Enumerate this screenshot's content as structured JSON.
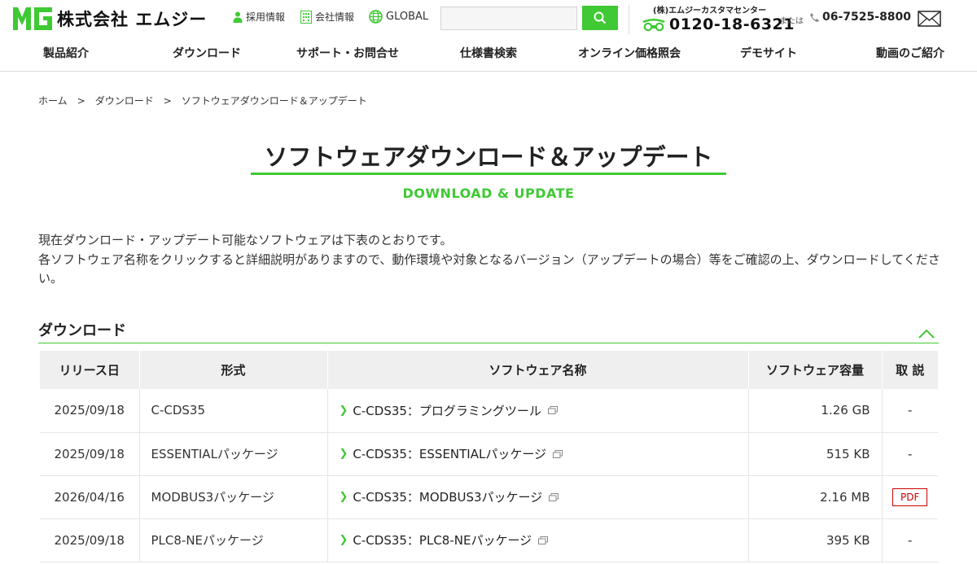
{
  "header": {
    "logo_mark": "MG",
    "logo_text": "株式会社 エムジー",
    "utility": {
      "recruit": "採用情報",
      "company": "会社情報",
      "global": "GLOBAL"
    },
    "search": {
      "placeholder": ""
    },
    "contact": {
      "center_label": "(株)エムジーカスタマセンター",
      "toll_free": "0120-18-6321",
      "or_label": "または",
      "phone": "06-7525-8800"
    },
    "nav": [
      "製品紹介",
      "ダウンロード",
      "サポート・お問合せ",
      "仕様書検索",
      "オンライン価格照会",
      "デモサイト",
      "動画のご紹介"
    ]
  },
  "breadcrumb": [
    "ホーム",
    "ダウンロード",
    "ソフトウェアダウンロード＆アップデート"
  ],
  "breadcrumb_sep": ">",
  "page": {
    "title": "ソフトウェアダウンロード＆アップデート",
    "subtitle": "DOWNLOAD & UPDATE",
    "intro_1": "現在ダウンロード・アップデート可能なソフトウェアは下表のとおりです。",
    "intro_2": "各ソフトウェア名称をクリックすると詳細説明がありますので、動作環境や対象となるバージョン（アップデートの場合）等をご確認の上、ダウンロードしてください。"
  },
  "section": {
    "title": "ダウンロード",
    "columns": [
      "リリース日",
      "形式",
      "ソフトウェア名称",
      "ソフトウェア容量",
      "取 説"
    ],
    "rows": [
      {
        "date": "2025/09/18",
        "type": "C-CDS35",
        "name": "C-CDS35：プログラミングツール",
        "size": "1.26 GB",
        "manual": "-"
      },
      {
        "date": "2025/09/18",
        "type": "ESSENTIALパッケージ",
        "name": "C-CDS35：ESSENTIALパッケージ",
        "size": "515 KB",
        "manual": "-"
      },
      {
        "date": "2026/04/16",
        "type": "MODBUS3パッケージ",
        "name": "C-CDS35：MODBUS3パッケージ",
        "size": "2.16 MB",
        "manual": "PDF"
      },
      {
        "date": "2025/09/18",
        "type": "PLC8-NEパッケージ",
        "name": "C-CDS35：PLC8-NEパッケージ",
        "size": "395 KB",
        "manual": "-"
      }
    ]
  },
  "colors": {
    "accent": "#3fc934",
    "pdf": "#cc0000"
  }
}
